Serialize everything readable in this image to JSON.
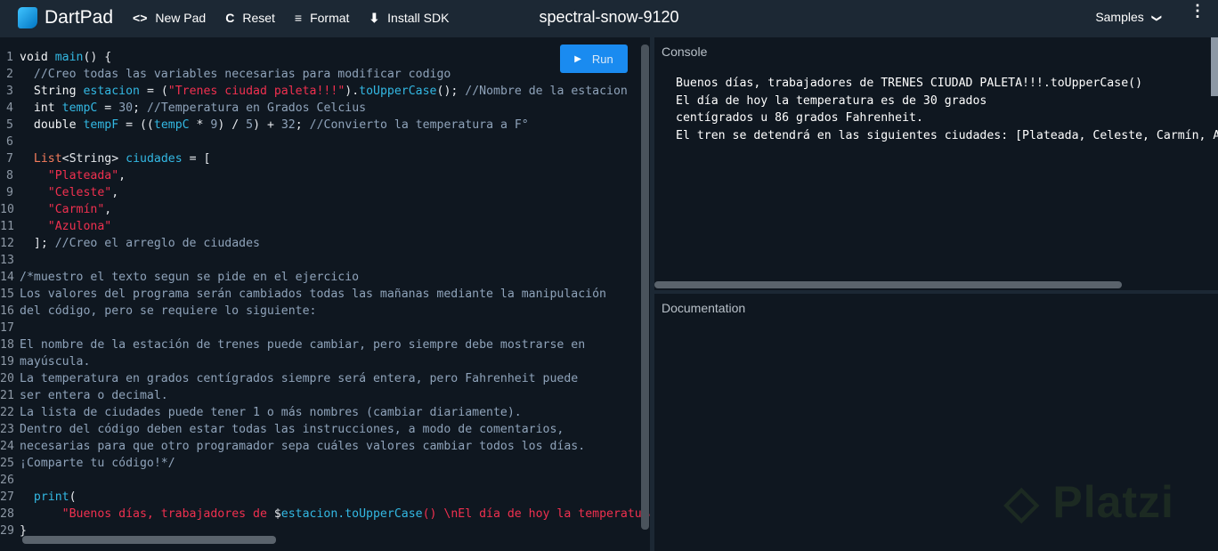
{
  "header": {
    "app_name": "DartPad",
    "buttons": [
      {
        "icon": "code-icon",
        "glyph": "<>",
        "label": "New Pad"
      },
      {
        "icon": "refresh-icon",
        "glyph": "C",
        "label": "Reset"
      },
      {
        "icon": "format-icon",
        "glyph": "≡",
        "label": "Format"
      },
      {
        "icon": "download-icon",
        "glyph": "⬇",
        "label": "Install SDK"
      }
    ],
    "title": "spectral-snow-9120",
    "samples_label": "Samples",
    "samples_chevron": "❯",
    "menu_glyph": "⋮"
  },
  "editor": {
    "run_label": "Run",
    "run_glyph": "▶",
    "lines": [
      [
        [
          "kw",
          "void "
        ],
        [
          "id",
          "main"
        ],
        [
          "pl",
          "() {"
        ]
      ],
      [
        [
          "pl",
          "  "
        ],
        [
          "com",
          "//Creo todas las variables necesarias para modificar codigo"
        ]
      ],
      [
        [
          "pl",
          "  "
        ],
        [
          "kw",
          "String "
        ],
        [
          "id",
          "estacion"
        ],
        [
          "pl",
          " = ("
        ],
        [
          "str",
          "\"Trenes ciudad paleta!!!\""
        ],
        [
          "pl",
          ")."
        ],
        [
          "id",
          "toUpperCase"
        ],
        [
          "pl",
          "(); "
        ],
        [
          "com",
          "//Nombre de la estacion"
        ]
      ],
      [
        [
          "pl",
          "  "
        ],
        [
          "kw",
          "int "
        ],
        [
          "id",
          "tempC"
        ],
        [
          "pl",
          " = "
        ],
        [
          "num",
          "30"
        ],
        [
          "pl",
          "; "
        ],
        [
          "com",
          "//Temperatura en Grados Celcius"
        ]
      ],
      [
        [
          "pl",
          "  "
        ],
        [
          "kw",
          "double "
        ],
        [
          "id",
          "tempF"
        ],
        [
          "pl",
          " = (("
        ],
        [
          "id",
          "tempC"
        ],
        [
          "pl",
          " * "
        ],
        [
          "num",
          "9"
        ],
        [
          "pl",
          ") / "
        ],
        [
          "num",
          "5"
        ],
        [
          "pl",
          ") + "
        ],
        [
          "num",
          "32"
        ],
        [
          "pl",
          "; "
        ],
        [
          "com",
          "//Convierto la temperatura a F°"
        ]
      ],
      [],
      [
        [
          "pl",
          "  "
        ],
        [
          "type",
          "List"
        ],
        [
          "pl",
          "<String> "
        ],
        [
          "id",
          "ciudades"
        ],
        [
          "pl",
          " = ["
        ]
      ],
      [
        [
          "pl",
          "    "
        ],
        [
          "str",
          "\"Plateada\""
        ],
        [
          "pl",
          ","
        ]
      ],
      [
        [
          "pl",
          "    "
        ],
        [
          "str",
          "\"Celeste\""
        ],
        [
          "pl",
          ","
        ]
      ],
      [
        [
          "pl",
          "    "
        ],
        [
          "str",
          "\"Carmín\""
        ],
        [
          "pl",
          ","
        ]
      ],
      [
        [
          "pl",
          "    "
        ],
        [
          "str",
          "\"Azulona\""
        ]
      ],
      [
        [
          "pl",
          "  ]; "
        ],
        [
          "com",
          "//Creo el arreglo de ciudades"
        ]
      ],
      [],
      [
        [
          "com",
          "/*muestro el texto segun se pide en el ejercicio"
        ]
      ],
      [
        [
          "com",
          "Los valores del programa serán cambiados todas las mañanas mediante la manipulación"
        ]
      ],
      [
        [
          "com",
          "del código, pero se requiere lo siguiente:"
        ]
      ],
      [],
      [
        [
          "com",
          "El nombre de la estación de trenes puede cambiar, pero siempre debe mostrarse en"
        ]
      ],
      [
        [
          "com",
          "mayúscula."
        ]
      ],
      [
        [
          "com",
          "La temperatura en grados centígrados siempre será entera, pero Fahrenheit puede"
        ]
      ],
      [
        [
          "com",
          "ser entera o decimal."
        ]
      ],
      [
        [
          "com",
          "La lista de ciudades puede tener 1 o más nombres (cambiar diariamente)."
        ]
      ],
      [
        [
          "com",
          "Dentro del código deben estar todas las instrucciones, a modo de comentarios,"
        ]
      ],
      [
        [
          "com",
          "necesarias para que otro programador sepa cuáles valores cambiar todos los días."
        ]
      ],
      [
        [
          "com",
          "¡Comparte tu código!*/"
        ]
      ],
      [],
      [
        [
          "pl",
          "  "
        ],
        [
          "id",
          "print"
        ],
        [
          "pl",
          "("
        ]
      ],
      [
        [
          "pl",
          "      "
        ],
        [
          "str",
          "\"Buenos días, trabajadores de "
        ],
        [
          "pl",
          "$"
        ],
        [
          "id",
          "estacion.toUpperCase"
        ],
        [
          "str",
          "() \\nEl día de hoy la temperatura"
        ]
      ],
      [
        [
          "pl",
          "}"
        ]
      ]
    ]
  },
  "console": {
    "label": "Console",
    "output": "Buenos días, trabajadores de TRENES CIUDAD PALETA!!!.toUpperCase()\nEl día de hoy la temperatura es de 30 grados\ncentígrados u 86 grados Fahrenheit.\nEl tren se detendrá en las siguientes ciudades: [Plateada, Celeste, Carmín, Azulona]"
  },
  "documentation": {
    "label": "Documentation"
  },
  "watermark": "Platzi"
}
